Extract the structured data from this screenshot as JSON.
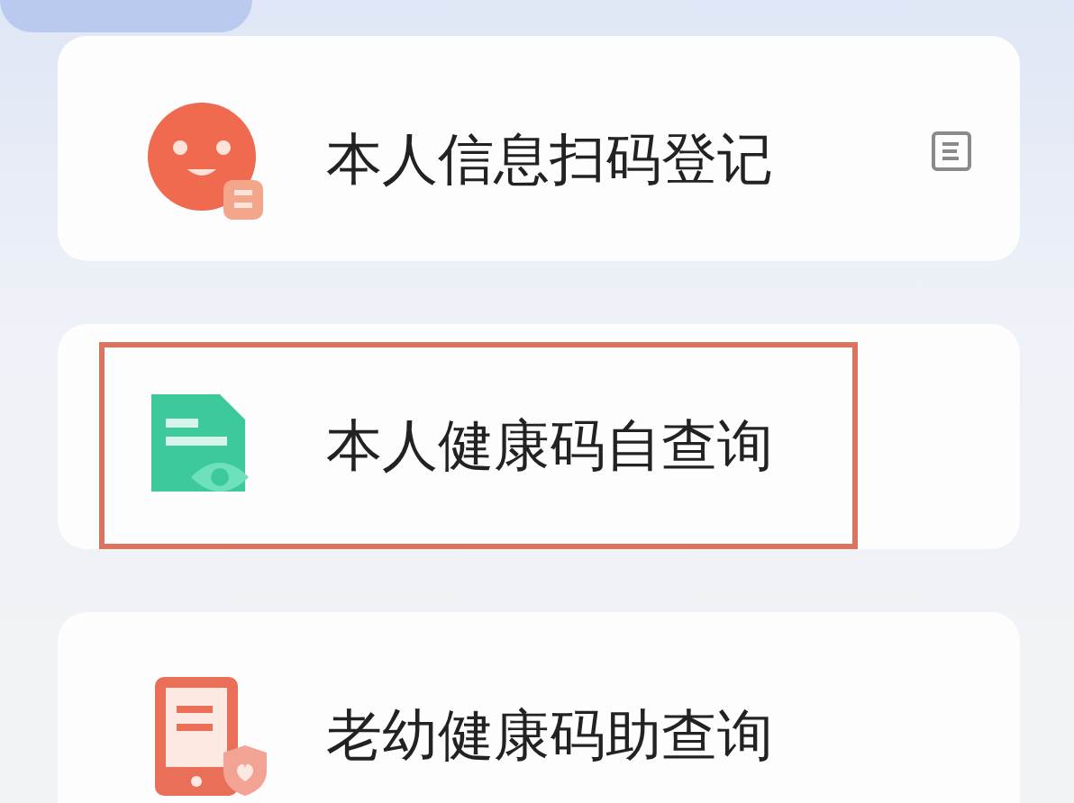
{
  "menu_items": [
    {
      "label": "本人信息扫码登记",
      "highlighted": false
    },
    {
      "label": "本人健康码自查询",
      "highlighted": true
    },
    {
      "label": "老幼健康码助查询",
      "highlighted": false
    }
  ]
}
